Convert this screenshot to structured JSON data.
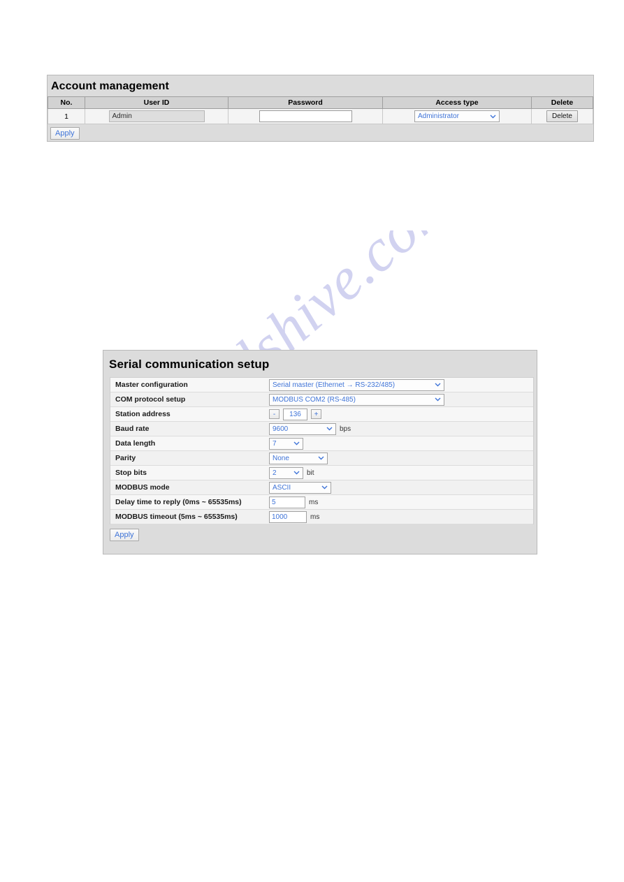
{
  "watermark": {
    "text": "manualshive.com"
  },
  "account_panel": {
    "title": "Account management",
    "columns": [
      "No.",
      "User ID",
      "Password",
      "Access type",
      "Delete"
    ],
    "rows": [
      {
        "no": "1",
        "user_id": "Admin",
        "password": "",
        "password_placeholder": "",
        "access_type": "Administrator",
        "delete_label": "Delete"
      }
    ],
    "apply_label": "Apply"
  },
  "serial_panel": {
    "title": "Serial communication setup",
    "rows": [
      {
        "label": "Master configuration",
        "type": "select",
        "value": "Serial master (Ethernet → RS-232/485)",
        "unit": ""
      },
      {
        "label": "COM protocol setup",
        "type": "select",
        "value": "MODBUS COM2 (RS-485)",
        "unit": ""
      },
      {
        "label": "Station address",
        "type": "stepper",
        "value": "136",
        "minus": "-",
        "plus": "+",
        "unit": ""
      },
      {
        "label": "Baud rate",
        "type": "select",
        "value": "9600",
        "unit": "bps"
      },
      {
        "label": "Data length",
        "type": "select",
        "value": "7",
        "unit": ""
      },
      {
        "label": "Parity",
        "type": "select",
        "value": "None",
        "unit": ""
      },
      {
        "label": "Stop bits",
        "type": "select",
        "value": "2",
        "unit": "bit"
      },
      {
        "label": "MODBUS mode",
        "type": "select",
        "value": "ASCII",
        "unit": ""
      },
      {
        "label": "Delay time to reply (0ms ~ 65535ms)",
        "type": "text",
        "value": "5",
        "unit": "ms"
      },
      {
        "label": "MODBUS timeout (5ms ~ 65535ms)",
        "type": "text",
        "value": "1000",
        "unit": "ms"
      }
    ],
    "apply_label": "Apply"
  },
  "colors": {
    "panel_bg": "#dcdcdc",
    "value_blue": "#3f74d8",
    "watermark": "#c9cbee"
  }
}
